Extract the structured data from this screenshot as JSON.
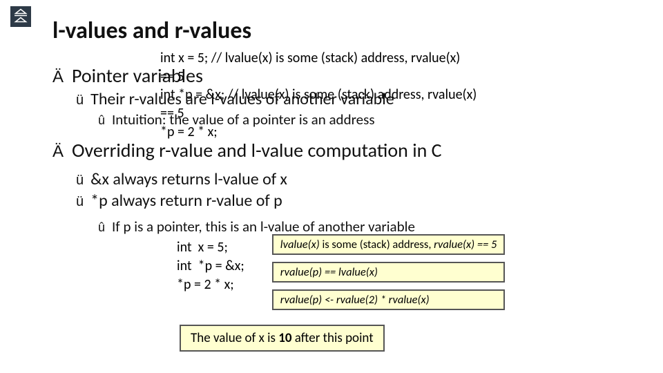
{
  "title": "l-values and r-values",
  "overlay": {
    "l1": "int  x = 5;  // lvalue(x) is some (stack) address, rvalue(x)",
    "l2": "== 5",
    "l3": "int  *p = &x;  // lvalue(x) is some (stack) address, rvalue(x)",
    "l4": "== 5",
    "l5": "*p = 2 * x;"
  },
  "bullets": {
    "a1": "Pointer variables",
    "a2": "Their r-values are l-values of another variable",
    "a3": "Intuition: the value of a pointer is an address",
    "b1": "Overriding r-value and l-value computation in C",
    "b2": "&x always returns l-value of x",
    "b3": "*p always return r-value of p",
    "b4": "If p is a pointer, this is an l-value of another variable"
  },
  "code": {
    "l1": "int  x = 5;",
    "l2": "int  *p = &x;",
    "l3": "*p = 2 * x;"
  },
  "boxes": {
    "box1_pre": "lvalue(x)",
    "box1_mid": " is some (stack) address, ",
    "box1_post": "rvalue(x) == 5",
    "box2_a": "rvalue(p) == lvalue(x)",
    "box3_a": "rvalue(p)  <-  rvalue(2)  *  rvalue(x)",
    "final_a": "The value of x is ",
    "final_b": "10",
    "final_c": " after this point"
  }
}
